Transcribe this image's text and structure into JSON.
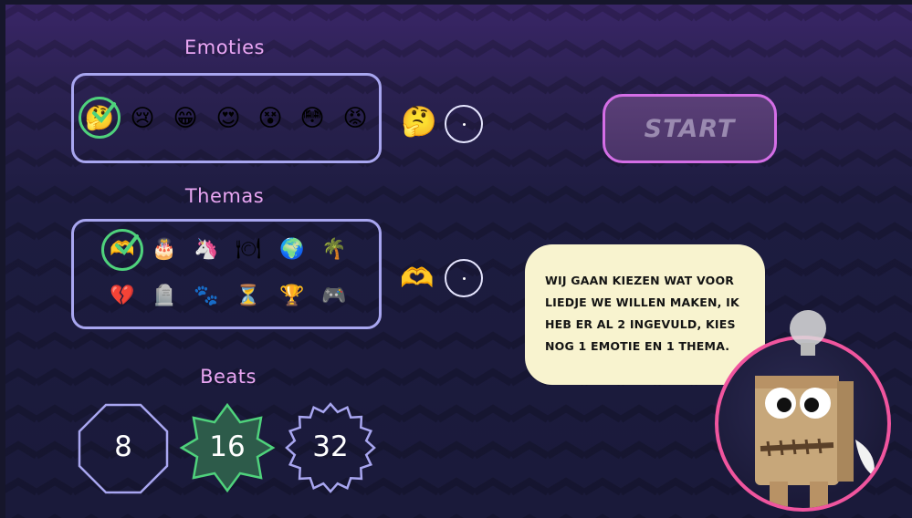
{
  "sections": {
    "emoties_title": "Emoties",
    "themas_title": "Themas",
    "beats_title": "Beats"
  },
  "emoties": {
    "items": [
      {
        "icon": "thinking-face-selected-icon",
        "glyph": "🤔",
        "selected": true
      },
      {
        "icon": "sad-tear-face-icon",
        "glyph": "😢",
        "selected": false
      },
      {
        "icon": "grinning-face-icon",
        "glyph": "😁",
        "selected": false
      },
      {
        "icon": "heart-eyes-face-icon",
        "glyph": "😍",
        "selected": false
      },
      {
        "icon": "dizzy-face-icon",
        "glyph": "😵",
        "selected": false
      },
      {
        "icon": "flushed-face-icon",
        "glyph": "😳",
        "selected": false
      },
      {
        "icon": "angry-face-icon",
        "glyph": "😡",
        "selected": false
      }
    ],
    "chosen_icon": "thinking-face-icon",
    "chosen_glyph": "🤔"
  },
  "themas": {
    "row1": [
      {
        "icon": "heart-hands-selected-icon",
        "glyph": "🫶",
        "selected": true
      },
      {
        "icon": "birthday-cake-icon",
        "glyph": "🎂"
      },
      {
        "icon": "unicorn-icon",
        "glyph": "🦄"
      },
      {
        "icon": "plate-cutlery-icon",
        "glyph": "🍽"
      },
      {
        "icon": "globe-icon",
        "glyph": "🌍"
      },
      {
        "icon": "palm-tree-icon",
        "glyph": "🌴"
      }
    ],
    "row2": [
      {
        "icon": "broken-heart-icon",
        "glyph": "💔"
      },
      {
        "icon": "gravestone-icon",
        "glyph": "🪦"
      },
      {
        "icon": "paw-prints-icon",
        "glyph": "🐾"
      },
      {
        "icon": "hourglass-icon",
        "glyph": "⏳"
      },
      {
        "icon": "trophy-icon",
        "glyph": "🏆"
      },
      {
        "icon": "game-controller-icon",
        "glyph": "🎮"
      }
    ],
    "chosen_icon": "heart-hands-icon",
    "chosen_glyph": "🫶"
  },
  "start_label": "START",
  "speech": "WIJ GAAN KIEZEN WAT VOOR LIEDJE WE WILLEN MAKEN, IK HEB ER AL 2 INGEVULD, KIES NOG 1 EMOTIE EN 1 THEMA.",
  "beats": [
    {
      "label": "8",
      "shape": "octagon",
      "selected": false
    },
    {
      "label": "16",
      "shape": "eight-point-star",
      "selected": true
    },
    {
      "label": "32",
      "shape": "spiky-star",
      "selected": false
    }
  ],
  "colors": {
    "accent_pink": "#e9a6f3",
    "panel_border": "#a8a6f0",
    "selected_green": "#4fd27c",
    "start_border": "#d46ee6",
    "avatar_ring": "#f0559e",
    "bubble_bg": "#f8f3cf"
  }
}
